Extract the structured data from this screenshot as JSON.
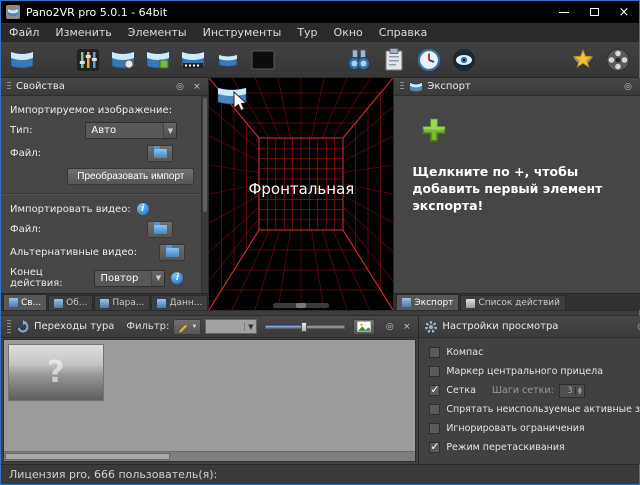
{
  "window": {
    "title": "Pano2VR pro 5.0.1 - 64bit"
  },
  "menu": {
    "items": [
      "Файл",
      "Изменить",
      "Элементы",
      "Инструменты",
      "Тур",
      "Окно",
      "Справка"
    ]
  },
  "toolbar": {
    "icons": [
      "input-panorama",
      "panorama-levels",
      "viewing-parameters",
      "patch-input",
      "transformation",
      "video-panorama",
      "blackout",
      "find-binoculars",
      "clipboard",
      "time",
      "preview-eye",
      "pro-star-badge",
      "media-reel"
    ]
  },
  "properties": {
    "title": "Свойства",
    "import_image_label": "Импортируемое изображение:",
    "type_label": "Тип:",
    "type_value": "Авто",
    "file_label": "Файл:",
    "convert_button": "Преобразовать импорт",
    "import_video_label": "Импортировать видео:",
    "video_file_label": "Файл:",
    "alt_video_label": "Альтернативные видео:",
    "end_action_label": "Конец действия:",
    "end_action_value": "Повтор",
    "tabs": [
      {
        "label": "Св..."
      },
      {
        "label": "Об..."
      },
      {
        "label": "Пара..."
      },
      {
        "label": "Данн..."
      }
    ]
  },
  "viewport": {
    "face_label": "Фронтальная"
  },
  "export": {
    "title": "Экспорт",
    "hint": "Щелкните по +, чтобы добавить первый элемент экспорта!",
    "tabs": [
      {
        "label": "Экспорт"
      },
      {
        "label": "Список действий"
      }
    ]
  },
  "tour": {
    "title": "Переходы тура",
    "filter_label": "Фильтр:",
    "placeholder_mark": "?"
  },
  "view_settings": {
    "title": "Настройки просмотра",
    "checkboxes": [
      {
        "label": "Компас",
        "checked": false
      },
      {
        "label": "Маркер центрального прицела",
        "checked": false
      },
      {
        "label": "Сетка",
        "checked": true
      },
      {
        "label": "Спрятать неиспользуемые активные зоны",
        "checked": false
      },
      {
        "label": "Игнорировать ограничения",
        "checked": false
      },
      {
        "label": "Режим перетаскивания",
        "checked": true
      }
    ],
    "grid_steps_label": "Шаги сетки:",
    "grid_steps_value": "3"
  },
  "status": {
    "text": "Лицензия pro, 666 пользователь(я):"
  }
}
